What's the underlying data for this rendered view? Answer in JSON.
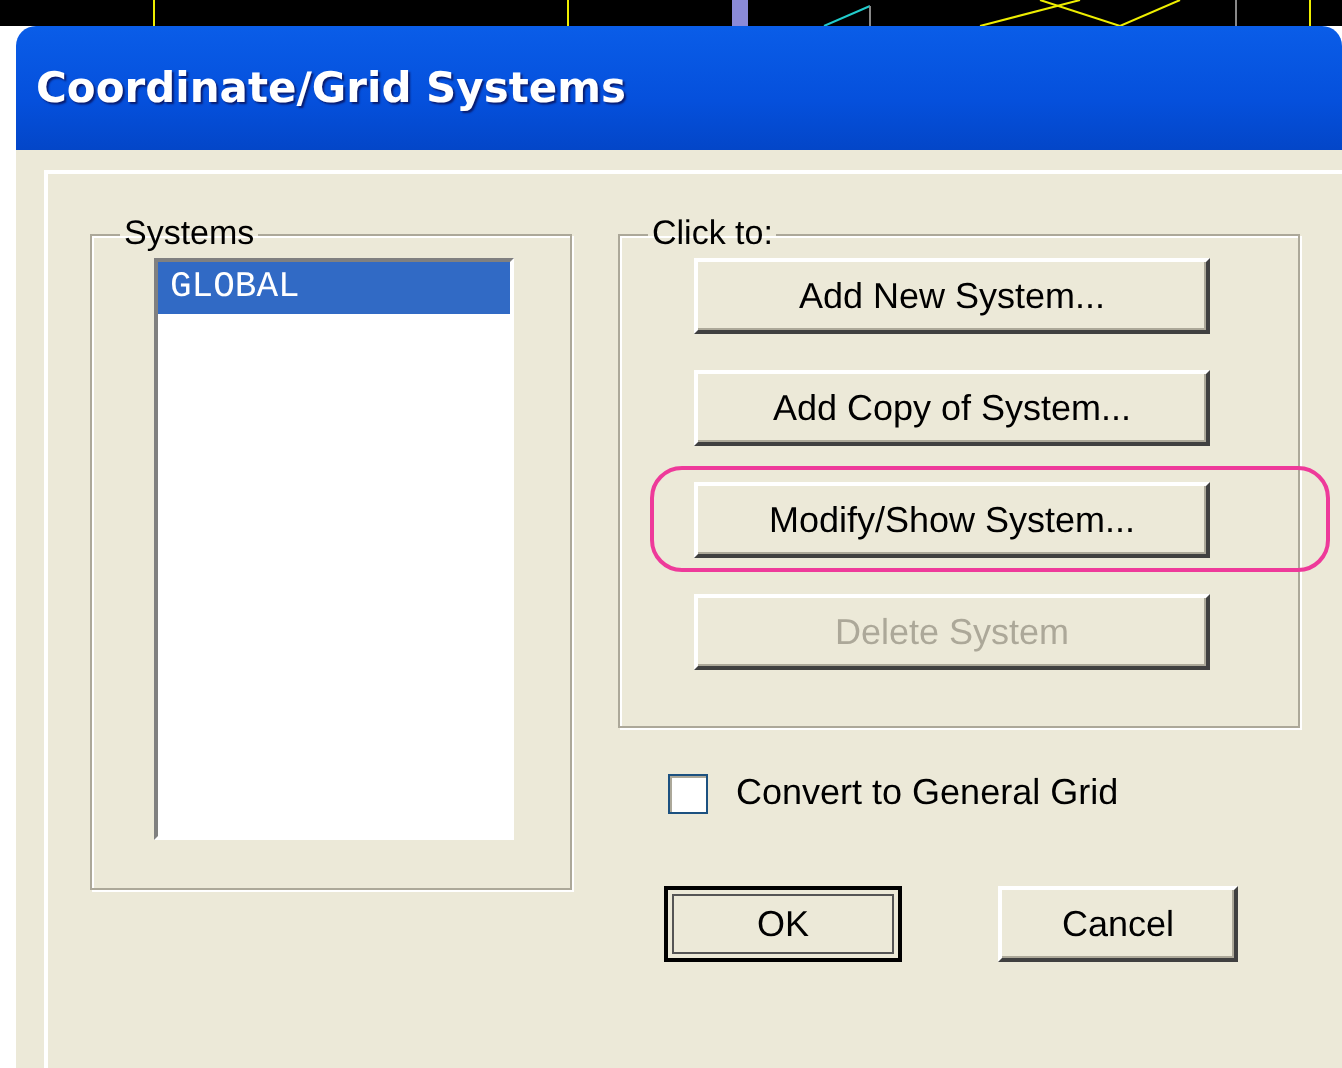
{
  "window": {
    "title": "Coordinate/Grid Systems"
  },
  "systems": {
    "label": "Systems",
    "items": [
      {
        "name": "GLOBAL",
        "selected": true
      }
    ]
  },
  "actions": {
    "label": "Click to:",
    "buttons": [
      {
        "label": "Add New System...",
        "disabled": false,
        "highlighted": false
      },
      {
        "label": "Add Copy of System...",
        "disabled": false,
        "highlighted": false
      },
      {
        "label": "Modify/Show System...",
        "disabled": false,
        "highlighted": true
      },
      {
        "label": "Delete System",
        "disabled": true,
        "highlighted": false
      }
    ]
  },
  "convert": {
    "label": "Convert to General Grid",
    "checked": false
  },
  "ok": {
    "label": "OK",
    "focused": true
  },
  "cancel": {
    "label": "Cancel"
  }
}
